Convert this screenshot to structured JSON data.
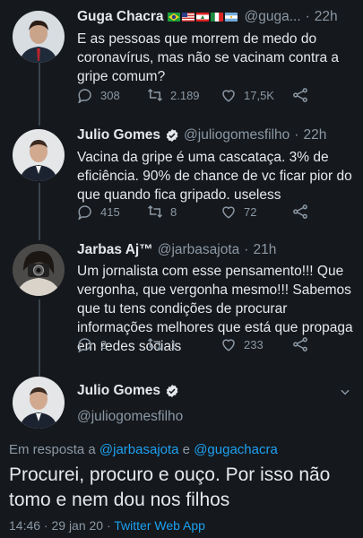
{
  "tweets": [
    {
      "name": "Guga Chacra",
      "flags": [
        "brazil-flag",
        "usa-flag",
        "lebanon-flag",
        "italy-flag",
        "argentina-flag"
      ],
      "handle": "@guga...",
      "time": "22h",
      "text": "E as pessoas que morrem de medo do coronavírus, mas não se vacinam contra a gripe comum?",
      "replies": "308",
      "retweets": "2.189",
      "likes": "17,5K"
    },
    {
      "name": "Julio Gomes",
      "handle": "@juliogomesfilho",
      "time": "22h",
      "text": "Vacina da gripe é uma cascataça. 3% de eficiência. 90% de chance de vc ficar pior do que quando fica gripado. useless",
      "replies": "415",
      "retweets": "8",
      "likes": "72"
    },
    {
      "name": "Jarbas Aj™",
      "handle": "@jarbasajota",
      "time": "21h",
      "text": "Um jornalista com esse pensamento!!! Que vergonha, que vergonha mesmo!!! Sabemos que tu tens condições de procurar informações melhores que está que propaga em redes sociais",
      "replies": "2",
      "retweets": "1",
      "likes": "233"
    }
  ],
  "main": {
    "name": "Julio Gomes",
    "handle": "@juliogomesfilho",
    "reply_prefix": "Em resposta a",
    "reply_user1": "@jarbasajota",
    "reply_and": "e",
    "reply_user2": "@gugachacra",
    "text": "Procurei, procuro e ouço. Por isso não tomo e nem dou nos filhos",
    "timestamp": "14:46 · 29 jan 20 · ",
    "app": "Twitter Web App"
  },
  "colors": {
    "background": "#15181c",
    "text": "#e6e9ec",
    "muted": "#8b98a5",
    "accent": "#1da1f2"
  }
}
